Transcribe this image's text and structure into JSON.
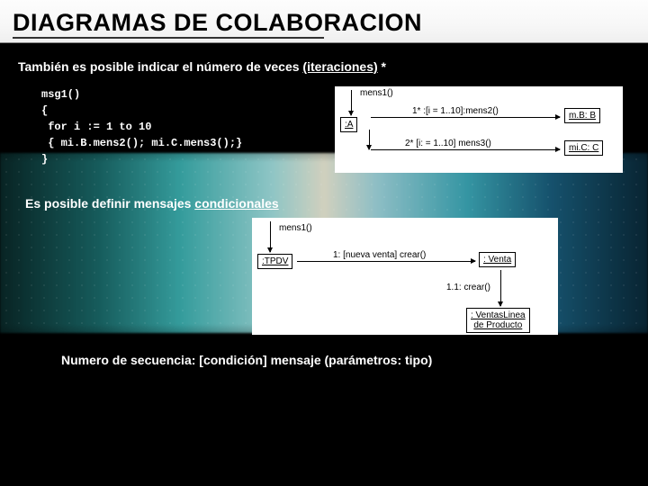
{
  "title": "DIAGRAMAS DE COLABORACION",
  "intro_prefix": "También es posible indicar el número de veces ",
  "intro_underlined": "(iteraciones)",
  "intro_suffix": " *",
  "code": {
    "l1": "msg1()",
    "l2": "{",
    "l3": " for i := 1 to 10",
    "l4": " { mi.B.mens2(); mi.C.mens3();}",
    "l5": "}"
  },
  "diagram1": {
    "mens1": "mens1()",
    "boxA": ":A",
    "arrow1": "1* :[i = 1..10]:mens2()",
    "boxB": "m.B: B",
    "arrow2": "2* [i: = 1..10] mens3()",
    "boxC": "mi.C: C"
  },
  "subtitle2_prefix": "Es posible definir mensajes ",
  "subtitle2_underlined": "condicionales",
  "diagram2": {
    "mens1": "mens1()",
    "boxTPDV": ":TPDV",
    "arrow1": "1: [nueva venta] crear()",
    "boxVenta": ": Venta",
    "arrow2": "1.1: crear()",
    "boxLinea1": ": VentasLinea",
    "boxLinea2": "de Producto"
  },
  "footer": "Numero de secuencia: [condición] mensaje (parámetros: tipo)"
}
